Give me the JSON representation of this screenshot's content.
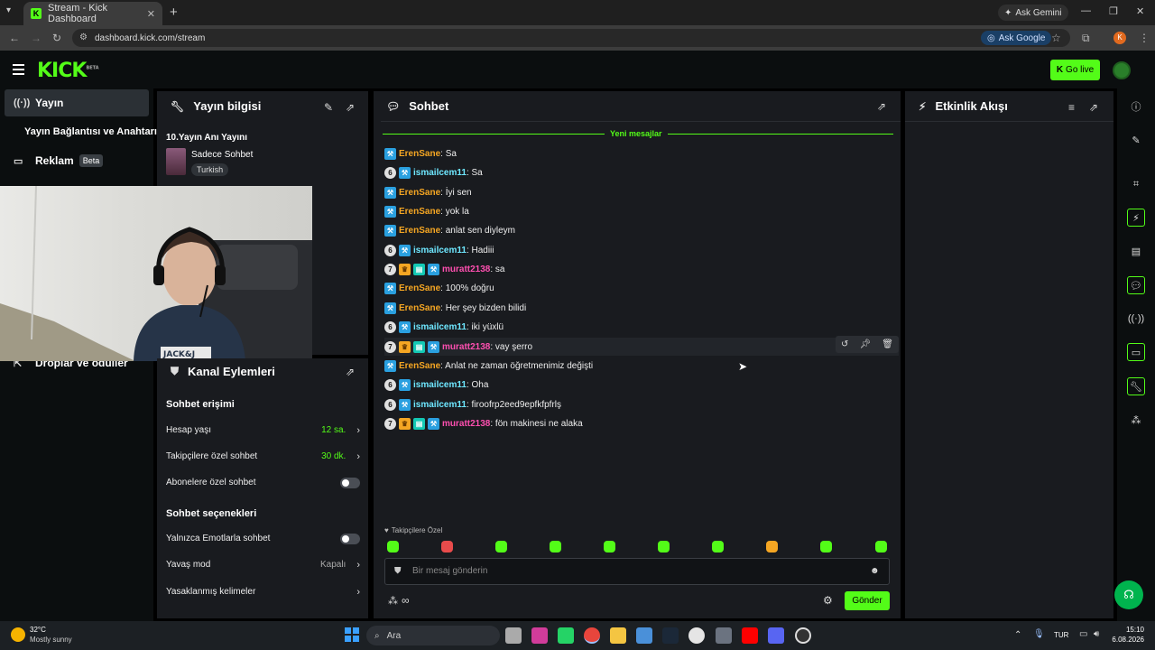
{
  "browser": {
    "tab_title": "Stream - Kick Dashboard",
    "url": "dashboard.kick.com/stream",
    "ask_gemini": "Ask Gemini",
    "ask_google": "Ask Google",
    "profile_initial": "K"
  },
  "header": {
    "logo": "KICK",
    "logo_tag": "BETA",
    "go_live": "Go live"
  },
  "sidebar": {
    "items": [
      {
        "label": "Yayın",
        "icon": "broadcast-icon"
      },
      {
        "label": "Yayın Bağlantısı ve Anahtarı"
      },
      {
        "label": "Reklam",
        "badge": "Beta",
        "icon": "ad-icon"
      },
      {
        "label": "Droplar ve ödüller",
        "icon": "gift-icon"
      }
    ]
  },
  "stream_info": {
    "title": "Yayın bilgisi",
    "stream_title": "10.Yayın Anı Yayını",
    "category": "Sadece Sohbet",
    "language": "Turkish"
  },
  "channel_actions": {
    "title": "Kanal Eylemleri",
    "chat_access_heading": "Sohbet erişimi",
    "chat_options_heading": "Sohbet seçenekleri",
    "rows": {
      "account_age": {
        "label": "Hesap yaşı",
        "value": "12 sa."
      },
      "followers_only": {
        "label": "Takipçilere özel sohbet",
        "value": "30 dk."
      },
      "subscribers_only": {
        "label": "Abonelere özel sohbet"
      },
      "emote_only": {
        "label": "Yalnızca Emotlarla sohbet"
      },
      "slow_mode": {
        "label": "Yavaş mod",
        "value": "Kapalı"
      },
      "banned_words": {
        "label": "Yasaklanmış kelimeler"
      }
    }
  },
  "chat": {
    "title": "Sohbet",
    "new_messages": "Yeni mesajlar",
    "messages": [
      {
        "user": "ErenSane",
        "text": ": Sa",
        "badges": [
          "mod"
        ],
        "color": "#f5a623"
      },
      {
        "user": "ismailcem11",
        "text": ": Sa",
        "badges": [
          "6",
          "mod"
        ],
        "color": "#6ee7ff"
      },
      {
        "user": "ErenSane",
        "text": ": İyi sen",
        "badges": [
          "mod"
        ],
        "color": "#f5a623"
      },
      {
        "user": "ErenSane",
        "text": ": yok la",
        "badges": [
          "mod"
        ],
        "color": "#f5a623"
      },
      {
        "user": "ErenSane",
        "text": ": anlat sen diyleym",
        "badges": [
          "mod"
        ],
        "color": "#f5a623"
      },
      {
        "user": "ismailcem11",
        "text": ": Hadiii",
        "badges": [
          "6",
          "mod"
        ],
        "color": "#6ee7ff"
      },
      {
        "user": "muratt2138",
        "text": ": sa",
        "badges": [
          "7",
          "crown",
          "gift",
          "mod"
        ],
        "color": "#ff4fb0"
      },
      {
        "user": "ErenSane",
        "text": ": 100% doğru",
        "badges": [
          "mod"
        ],
        "color": "#f5a623"
      },
      {
        "user": "ErenSane",
        "text": ": Her şey bizden bilidi",
        "badges": [
          "mod"
        ],
        "color": "#f5a623"
      },
      {
        "user": "ismailcem11",
        "text": ": iki yüxlü",
        "badges": [
          "6",
          "mod"
        ],
        "color": "#6ee7ff"
      },
      {
        "user": "muratt2138",
        "text": ": vay şerro",
        "badges": [
          "7",
          "crown",
          "gift",
          "mod"
        ],
        "color": "#ff4fb0"
      },
      {
        "user": "ErenSane",
        "text": ": Anlat ne zaman öğretmenimiz değişti",
        "badges": [
          "mod"
        ],
        "color": "#f5a623"
      },
      {
        "user": "ismailcem11",
        "text": ": Oha",
        "badges": [
          "6",
          "mod"
        ],
        "color": "#6ee7ff"
      },
      {
        "user": "ismailcem11",
        "text": ": firoofrp2eed9epfkfpfrlş",
        "badges": [
          "6",
          "mod"
        ],
        "color": "#6ee7ff"
      },
      {
        "user": "muratt2138",
        "text": ": fön makinesi ne alaka",
        "badges": [
          "7",
          "crown",
          "gift",
          "mod"
        ],
        "color": "#ff4fb0"
      }
    ],
    "followers_only_label": "Takipçilere Özel",
    "input_placeholder": "Bir mesaj gönderin",
    "send_button": "Gönder"
  },
  "activity": {
    "title": "Etkinlik Akışı"
  },
  "taskbar": {
    "weather_temp": "32°C",
    "weather_desc": "Mostly sunny",
    "search": "Ara",
    "lang": "TUR",
    "time": "15:10",
    "date": "6.08.2026"
  }
}
